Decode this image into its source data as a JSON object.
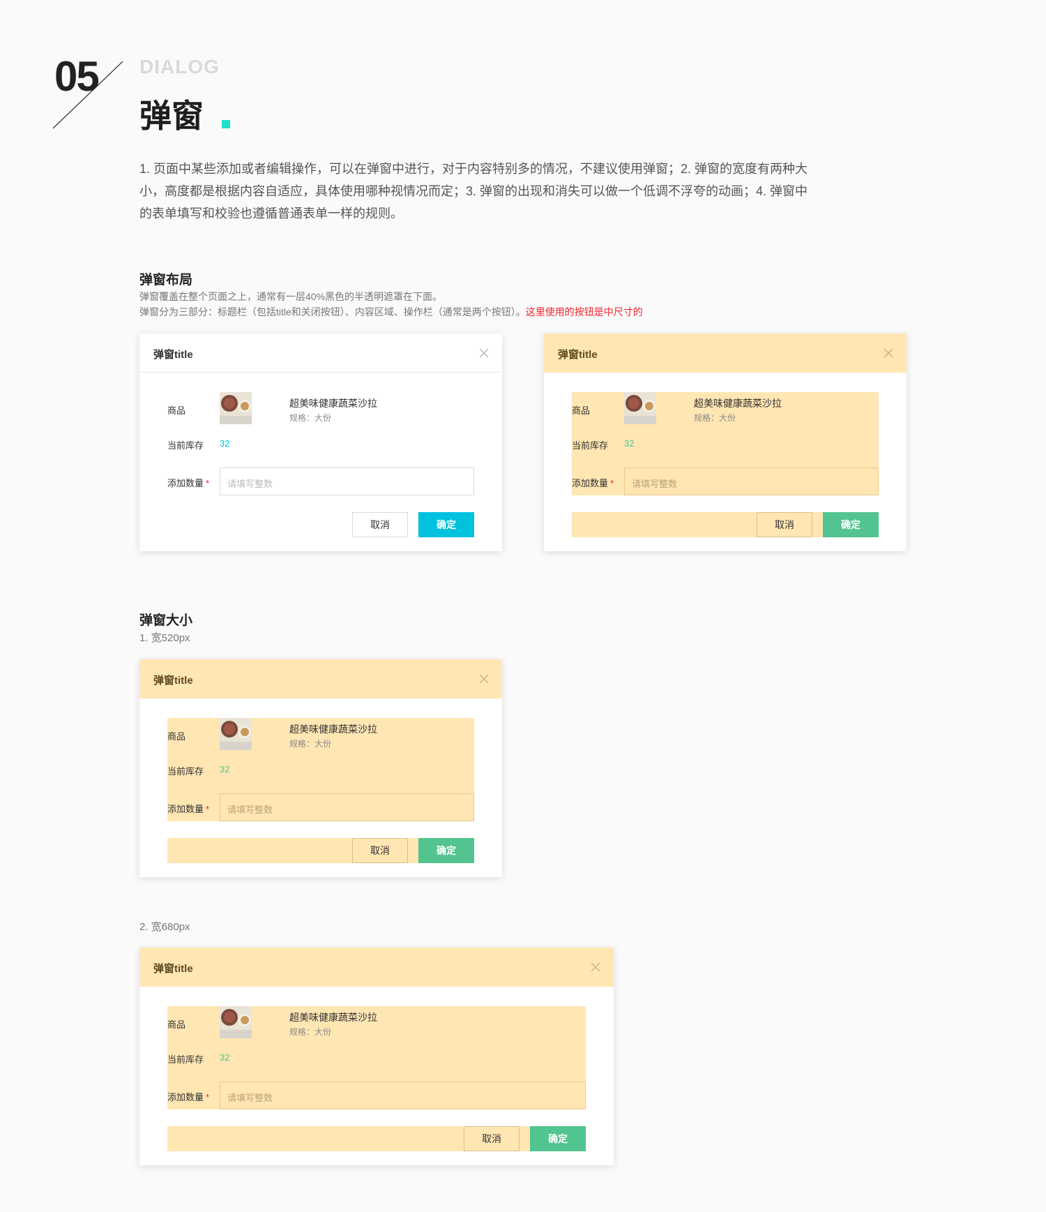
{
  "header": {
    "number": "05",
    "en_title": "DIALOG",
    "cn_title": "弹窗"
  },
  "intro": "1. 页面中某些添加或者编辑操作，可以在弹窗中进行，对于内容特别多的情况，不建议使用弹窗；2. 弹窗的宽度有两种大小，高度都是根据内容自适应，具体使用哪种视情况而定；3. 弹窗的出现和消失可以做一个低调不浮夸的动画；4. 弹窗中的表单填写和校验也遵循普通表单一样的规则。",
  "layout_section": {
    "title": "弹窗布局",
    "desc1": "弹窗覆盖在整个页面之上，通常有一层40%黑色的半透明遮罩在下面。",
    "desc2_a": "弹窗分为三部分：标题栏（包括title和关闭按钮）、内容区域、操作栏（通常是两个按钮）。",
    "desc2_b": "这里使用的按钮是中尺寸的"
  },
  "size_section": {
    "title": "弹窗大小",
    "size1": "1. 宽520px",
    "size2": "2. 宽680px"
  },
  "dialog": {
    "title": "弹窗title",
    "product_label": "商品",
    "product_name": "超美味健康蔬菜沙拉",
    "product_spec": "规格：大份",
    "stock_label": "当前库存",
    "stock_value": "32",
    "qty_label": "添加数量",
    "qty_required": "*",
    "qty_placeholder": "请填写整数",
    "cancel_label": "取消",
    "ok_label": "确定"
  },
  "colors": {
    "accent": "#00c1de",
    "accent_mark": "#1fe0c6",
    "highlight": "#ffe6b3",
    "ok_green": "#52c48f",
    "required": "#f5222d"
  }
}
